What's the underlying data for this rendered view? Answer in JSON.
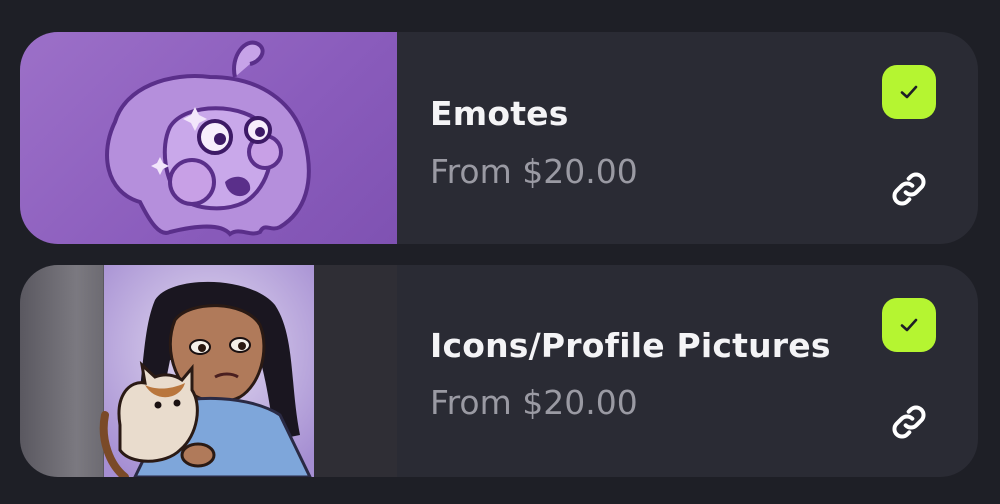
{
  "listings": [
    {
      "title": "Emotes",
      "price": "From $20.00",
      "selected": true,
      "thumbnail_icon": "purple-blob-emote-illustration",
      "link_icon": "link-icon",
      "check_icon": "checkmark-icon"
    },
    {
      "title": "Icons/Profile Pictures",
      "price": "From $20.00",
      "selected": true,
      "thumbnail_icon": "person-holding-cat-illustration",
      "link_icon": "link-icon",
      "check_icon": "checkmark-icon"
    }
  ],
  "colors": {
    "background": "#1e1f26",
    "card": "#2a2b34",
    "accent_check": "#b5f531",
    "title_text": "#f4f4f6",
    "price_text": "#9a9aa3",
    "emote_thumb": "#9163c1"
  }
}
